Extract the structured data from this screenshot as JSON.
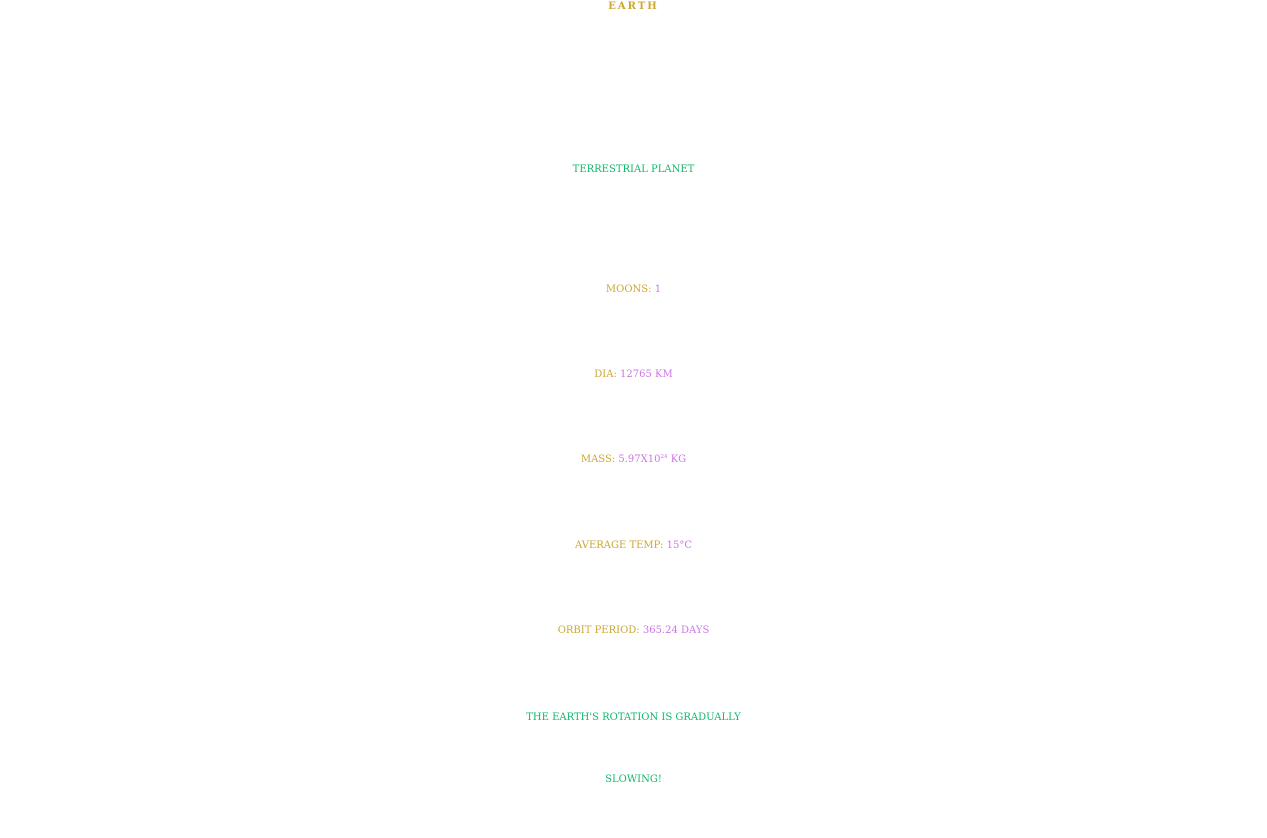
{
  "colors": {
    "gold": "#cba733",
    "green": "#12b86a",
    "violet": "#cf74e6"
  },
  "title": "EARTH",
  "subtitle": "TERRESTRIAL PLANET",
  "stats": {
    "moons": {
      "label": "MOONS:",
      "value": "1"
    },
    "diameter": {
      "label": "DIA:",
      "value": "12765 KM"
    },
    "mass": {
      "label": "MASS:",
      "base": "5.97X10",
      "exponent": "24",
      "unit": "KG"
    },
    "temperature": {
      "label": "AVERAGE TEMP:",
      "value": "15°C"
    },
    "orbit": {
      "label": "ORBIT PERIOD:",
      "value": "365.24 DAYS"
    }
  },
  "fact": {
    "line1": "THE EARTH'S ROTATION IS GRADUALLY",
    "line2": "SLOWING!"
  }
}
